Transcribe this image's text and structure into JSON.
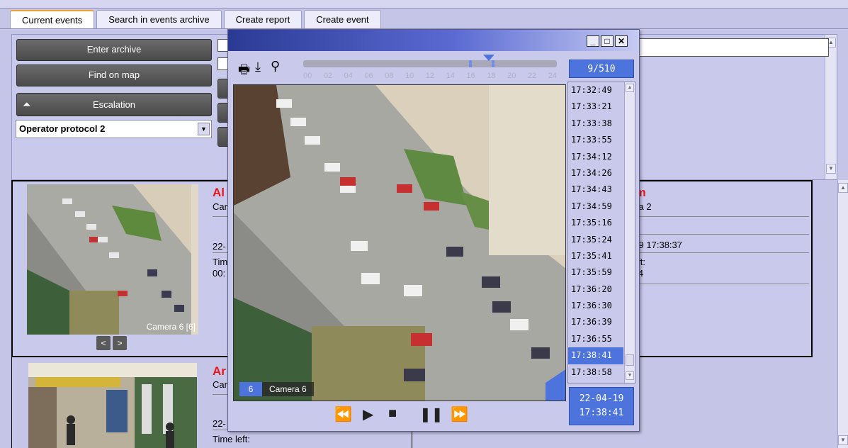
{
  "tabs": [
    {
      "label": "Current events",
      "active": true
    },
    {
      "label": "Search in events archive",
      "active": false
    },
    {
      "label": "Create report",
      "active": false
    },
    {
      "label": "Create event",
      "active": false
    }
  ],
  "controls": {
    "enter_archive": "Enter archive",
    "find_on_map": "Find on map",
    "escalation": "Escalation",
    "protocol_select": "Operator protocol 2"
  },
  "event1": {
    "title_fragment": "Al",
    "camera_fragment": "Car",
    "date_fragment": "22-",
    "time_left_fragment": "Tim",
    "time_left_value_fragment": "00:",
    "thumb_caption": "Camera 6 [6]",
    "nav_prev": "<",
    "nav_next": ">"
  },
  "event1_right": {
    "title_fragment": "rm",
    "camera_fragment": "era 2",
    "datetime_fragment": "-19 17:38:37",
    "time_left_fragment": "left:",
    "time_left_value_fragment": ":44"
  },
  "event2": {
    "title_fragment": "Ar",
    "camera_fragment": "Car",
    "date_fragment": "22-",
    "time_left": "Time left:"
  },
  "popup": {
    "counter": "9/510",
    "timeline_ticks": [
      "00",
      "02",
      "04",
      "06",
      "08",
      "10",
      "12",
      "14",
      "16",
      "18",
      "20",
      "22",
      "24"
    ],
    "camera_number": "6",
    "camera_name": "Camera 6",
    "times": [
      "17:32:49",
      "17:33:21",
      "17:33:38",
      "17:33:55",
      "17:34:12",
      "17:34:26",
      "17:34:43",
      "17:34:59",
      "17:35:16",
      "17:35:24",
      "17:35:41",
      "17:35:59",
      "17:36:20",
      "17:36:30",
      "17:36:39",
      "17:36:55",
      "17:38:41",
      "17:38:58"
    ],
    "selected_time": "17:38:41",
    "date_display": "22-04-19",
    "time_display": "17:38:41"
  },
  "colors": {
    "accent": "#4d74dd",
    "alarm": "#e8171c",
    "panel": "#c9c9ec"
  }
}
